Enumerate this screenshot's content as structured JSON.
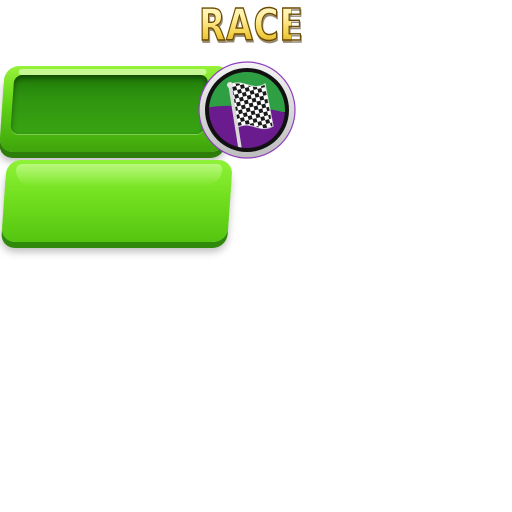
{
  "title": {
    "text": "RACE"
  },
  "buttons": {
    "top": {
      "state": "pressed"
    },
    "bottom": {
      "state": "normal"
    }
  },
  "emblem": {
    "icon": "checkered-flag-icon"
  },
  "colors": {
    "button_green": "#72e01e",
    "button_dark_green": "#2f9510",
    "emblem_green": "#2ea043",
    "emblem_purple": "#6a1b8e",
    "title_gold": "#f2cf45"
  }
}
